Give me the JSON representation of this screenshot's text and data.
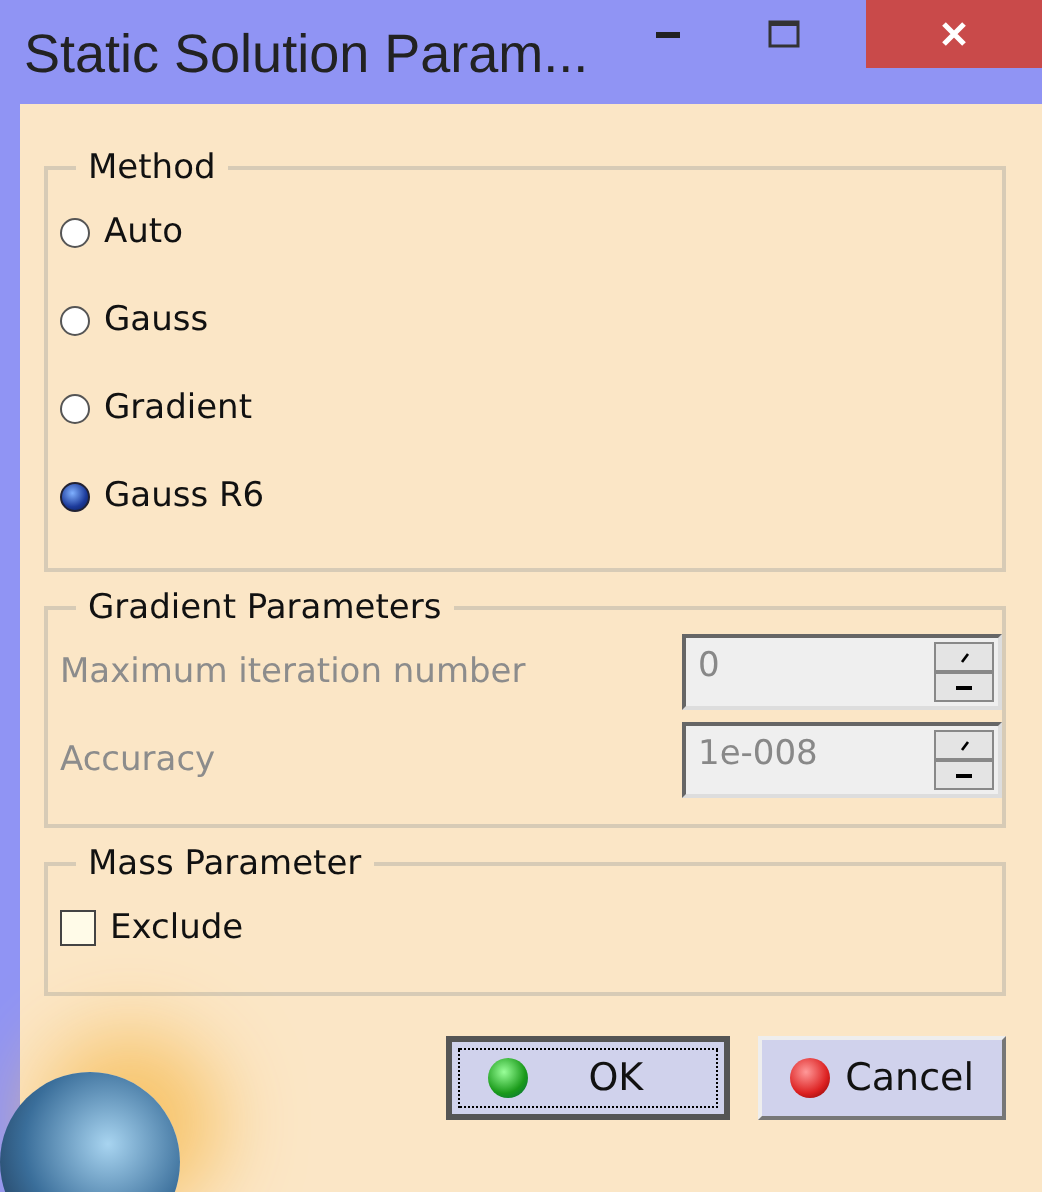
{
  "window": {
    "title": "Static Solution Param..."
  },
  "method": {
    "title": "Method",
    "options": [
      {
        "label": "Auto",
        "selected": false
      },
      {
        "label": "Gauss",
        "selected": false
      },
      {
        "label": "Gradient",
        "selected": false
      },
      {
        "label": "Gauss R6",
        "selected": true
      }
    ]
  },
  "gradient_parameters": {
    "title": "Gradient Parameters",
    "fields": [
      {
        "label": "Maximum iteration number",
        "value": "0",
        "disabled": true
      },
      {
        "label": "Accuracy",
        "value": "1e-008",
        "disabled": true
      }
    ]
  },
  "mass_parameter": {
    "title": "Mass Parameter",
    "checkbox": {
      "label": "Exclude",
      "checked": false
    }
  },
  "buttons": [
    {
      "label": "OK",
      "kind": "ok",
      "focused": true
    },
    {
      "label": "Cancel",
      "kind": "cancel",
      "focused": false
    }
  ]
}
